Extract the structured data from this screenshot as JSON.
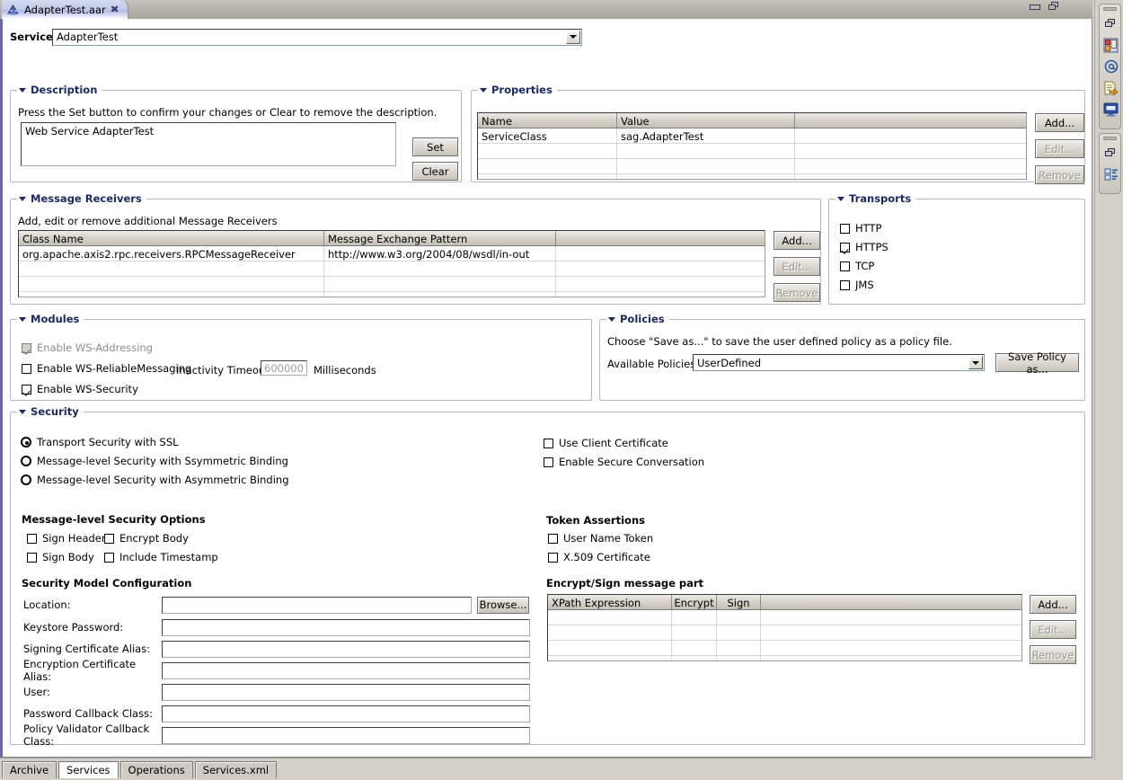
{
  "window": {
    "editor_tab": {
      "title": "AdapterTest.aar",
      "icon": "axis-archive-icon",
      "close": "✖"
    },
    "controls": {
      "minimize": "minimize-icon",
      "maximize": "maximize-icon"
    }
  },
  "service": {
    "label": "Service:",
    "value": "AdapterTest",
    "options": [
      "AdapterTest"
    ]
  },
  "description": {
    "title": "Description",
    "hint": "Press the Set button to confirm your changes or Clear to remove the description.",
    "text": "Web Service AdapterTest",
    "set_label": "Set",
    "clear_label": "Clear"
  },
  "properties": {
    "title": "Properties",
    "columns": [
      "Name",
      "Value",
      ""
    ],
    "rows": [
      [
        "ServiceClass",
        "sag.AdapterTest",
        ""
      ],
      [
        "",
        "",
        ""
      ],
      [
        "",
        "",
        ""
      ],
      [
        "",
        "",
        ""
      ]
    ],
    "add_label": "Add...",
    "edit_label": "Edit...",
    "remove_label": "Remove"
  },
  "message_receivers": {
    "title": "Message Receivers",
    "hint": "Add, edit or remove additional Message Receivers",
    "columns": [
      "Class Name",
      "Message Exchange Pattern",
      ""
    ],
    "rows": [
      [
        "org.apache.axis2.rpc.receivers.RPCMessageReceiver",
        "http://www.w3.org/2004/08/wsdl/in-out",
        ""
      ],
      [
        "",
        "",
        ""
      ],
      [
        "",
        "",
        ""
      ],
      [
        "",
        "",
        ""
      ]
    ],
    "add_label": "Add...",
    "edit_label": "Edit...",
    "remove_label": "Remove"
  },
  "transports": {
    "title": "Transports",
    "items": [
      {
        "label": "HTTP",
        "checked": false
      },
      {
        "label": "HTTPS",
        "checked": true
      },
      {
        "label": "TCP",
        "checked": false
      },
      {
        "label": "JMS",
        "checked": false
      }
    ]
  },
  "modules": {
    "title": "Modules",
    "ws_addressing": {
      "label": "Enable WS-Addressing",
      "checked": true,
      "disabled": true
    },
    "ws_reliable": {
      "label": "Enable WS-ReliableMessaging",
      "checked": false
    },
    "inactivity_timeout_label": "Inactivity Timeout",
    "inactivity_timeout_value": "600000",
    "milliseconds_label": "Milliseconds",
    "ws_security": {
      "label": "Enable WS-Security",
      "checked": true
    }
  },
  "policies": {
    "title": "Policies",
    "hint": "Choose \"Save as...\" to save the user defined policy as a policy file.",
    "available_label": "Available Policies:",
    "available_value": "UserDefined",
    "save_policy_label": "Save Policy as..."
  },
  "security": {
    "title": "Security",
    "modes": [
      {
        "label": "Transport Security with SSL",
        "selected": true
      },
      {
        "label": "Message-level Security with Ssymmetric Binding",
        "selected": false
      },
      {
        "label": "Message-level Security with Asymmetric Binding",
        "selected": false
      }
    ],
    "right_checks": [
      {
        "label": "Use Client Certificate",
        "checked": false
      },
      {
        "label": "Enable Secure Conversation",
        "checked": false
      }
    ],
    "msg_options_title": "Message-level Security Options",
    "msg_options": [
      {
        "label": "Sign Header",
        "checked": false
      },
      {
        "label": "Encrypt Body",
        "checked": false
      },
      {
        "label": "Sign Body",
        "checked": false
      },
      {
        "label": "Include Timestamp",
        "checked": false
      }
    ],
    "token_assertions_title": "Token Assertions",
    "token_assertions": [
      {
        "label": "User Name Token",
        "checked": false
      },
      {
        "label": "X.509 Certificate",
        "checked": false
      }
    ],
    "model_config_title": "Security Model Configuration",
    "fields": [
      {
        "label": "Location:",
        "value": ""
      },
      {
        "label": "Keystore Password:",
        "value": ""
      },
      {
        "label": "Signing Certificate Alias:",
        "value": ""
      },
      {
        "label": "Encryption Certificate Alias:",
        "value": ""
      },
      {
        "label": "User:",
        "value": ""
      },
      {
        "label": "Password Callback Class:",
        "value": ""
      },
      {
        "label": "Policy Validator Callback Class:",
        "value": ""
      }
    ],
    "browse_label": "Browse...",
    "encrypt_sign_title": "Encrypt/Sign message part",
    "encrypt_sign_columns": [
      "XPath Expression",
      "Encrypt",
      "Sign",
      ""
    ],
    "encrypt_sign_rows": [
      [
        "",
        "",
        "",
        ""
      ],
      [
        "",
        "",
        "",
        ""
      ],
      [
        "",
        "",
        "",
        ""
      ],
      [
        "",
        "",
        "",
        ""
      ]
    ],
    "add_label": "Add...",
    "edit_label": "Edit...",
    "remove_label": "Remove"
  },
  "bottom_tabs": [
    {
      "label": "Archive",
      "active": false
    },
    {
      "label": "Services",
      "active": true
    },
    {
      "label": "Operations",
      "active": false
    },
    {
      "label": "Services.xml",
      "active": false
    }
  ],
  "sidebar": {
    "group1": [
      "restore-icon",
      "server-package-icon",
      "at-sign-icon",
      "document-export-icon",
      "console-monitor-icon"
    ],
    "group2": [
      "restore-icon",
      "outline-tree-icon"
    ]
  }
}
